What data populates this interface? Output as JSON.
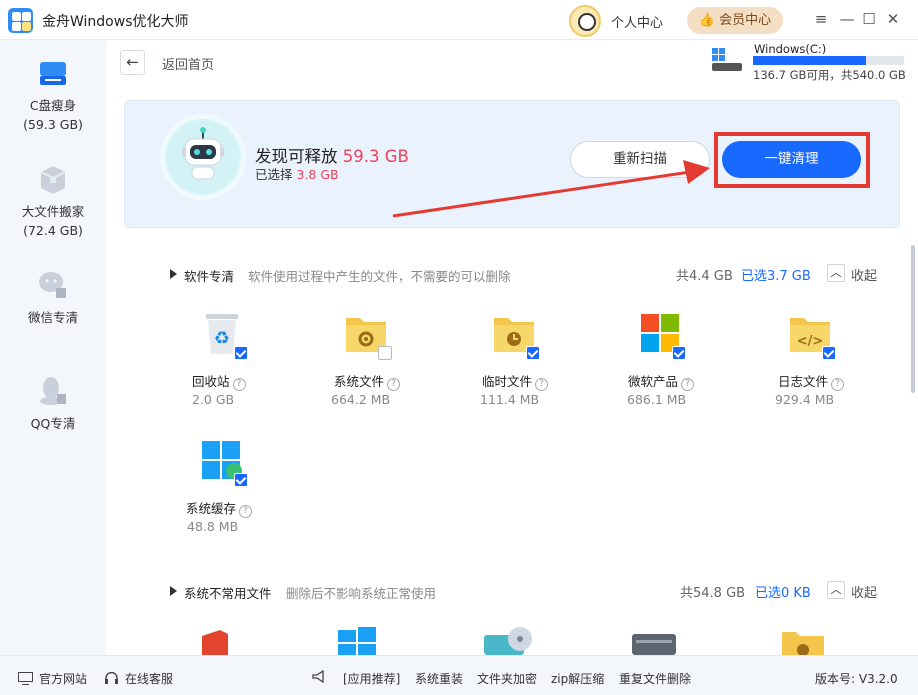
{
  "app": {
    "title": "金舟Windows优化大师"
  },
  "header": {
    "profile_label": "个人中心",
    "vip_label": "会员中心",
    "minimize": "—",
    "maximize": "☐",
    "close": "✕",
    "settings": "≡"
  },
  "sidebar": {
    "items": [
      {
        "label": "C盘瘦身",
        "sub": "(59.3 GB)",
        "icon": "drive-icon"
      },
      {
        "label": "大文件搬家",
        "sub": "(72.4 GB)",
        "icon": "box-icon"
      },
      {
        "label": "微信专清",
        "sub": "",
        "icon": "wechat-icon"
      },
      {
        "label": "QQ专清",
        "sub": "",
        "icon": "qq-icon"
      }
    ]
  },
  "nav": {
    "back_label": "返回首页"
  },
  "drive": {
    "name": "Windows(C:)",
    "info": "136.7 GB可用，共540.0 GB",
    "used_fraction": 0.747
  },
  "summary": {
    "found_prefix": "发现可释放",
    "found_value": "59.3 GB",
    "selected_prefix": "已选择",
    "selected_value": "3.8 GB",
    "rescan_label": "重新扫描",
    "clean_label": "一键清理"
  },
  "sections": [
    {
      "title": "软件专清",
      "desc": "软件使用过程中产生的文件，不需要的可以删除",
      "total": "共4.4 GB",
      "selected": "已选3.7 GB",
      "collapse": "收起",
      "items": [
        {
          "name": "回收站",
          "size": "2.0 GB",
          "checked": true
        },
        {
          "name": "系统文件",
          "size": "664.2 MB",
          "checked": false
        },
        {
          "name": "临时文件",
          "size": "111.4 MB",
          "checked": true
        },
        {
          "name": "微软产品",
          "size": "686.1 MB",
          "checked": true
        },
        {
          "name": "日志文件",
          "size": "929.4 MB",
          "checked": true
        },
        {
          "name": "系统缓存",
          "size": "48.8 MB",
          "checked": true
        }
      ]
    },
    {
      "title": "系统不常用文件",
      "desc": "删除后不影响系统正常使用",
      "total": "共54.8 GB",
      "selected": "已选0 KB",
      "collapse": "收起"
    }
  ],
  "footer": {
    "website": "官方网站",
    "support": "在线客服",
    "apps_tag": "[应用推荐]",
    "reinstall": "系统重装",
    "encrypt": "文件夹加密",
    "zip": "zip解压缩",
    "dedupe": "重复文件删除",
    "version": "版本号: V3.2.0"
  },
  "colors": {
    "accent": "#1769ff",
    "highlight": "#e33b32",
    "value_red": "#f0405a"
  }
}
